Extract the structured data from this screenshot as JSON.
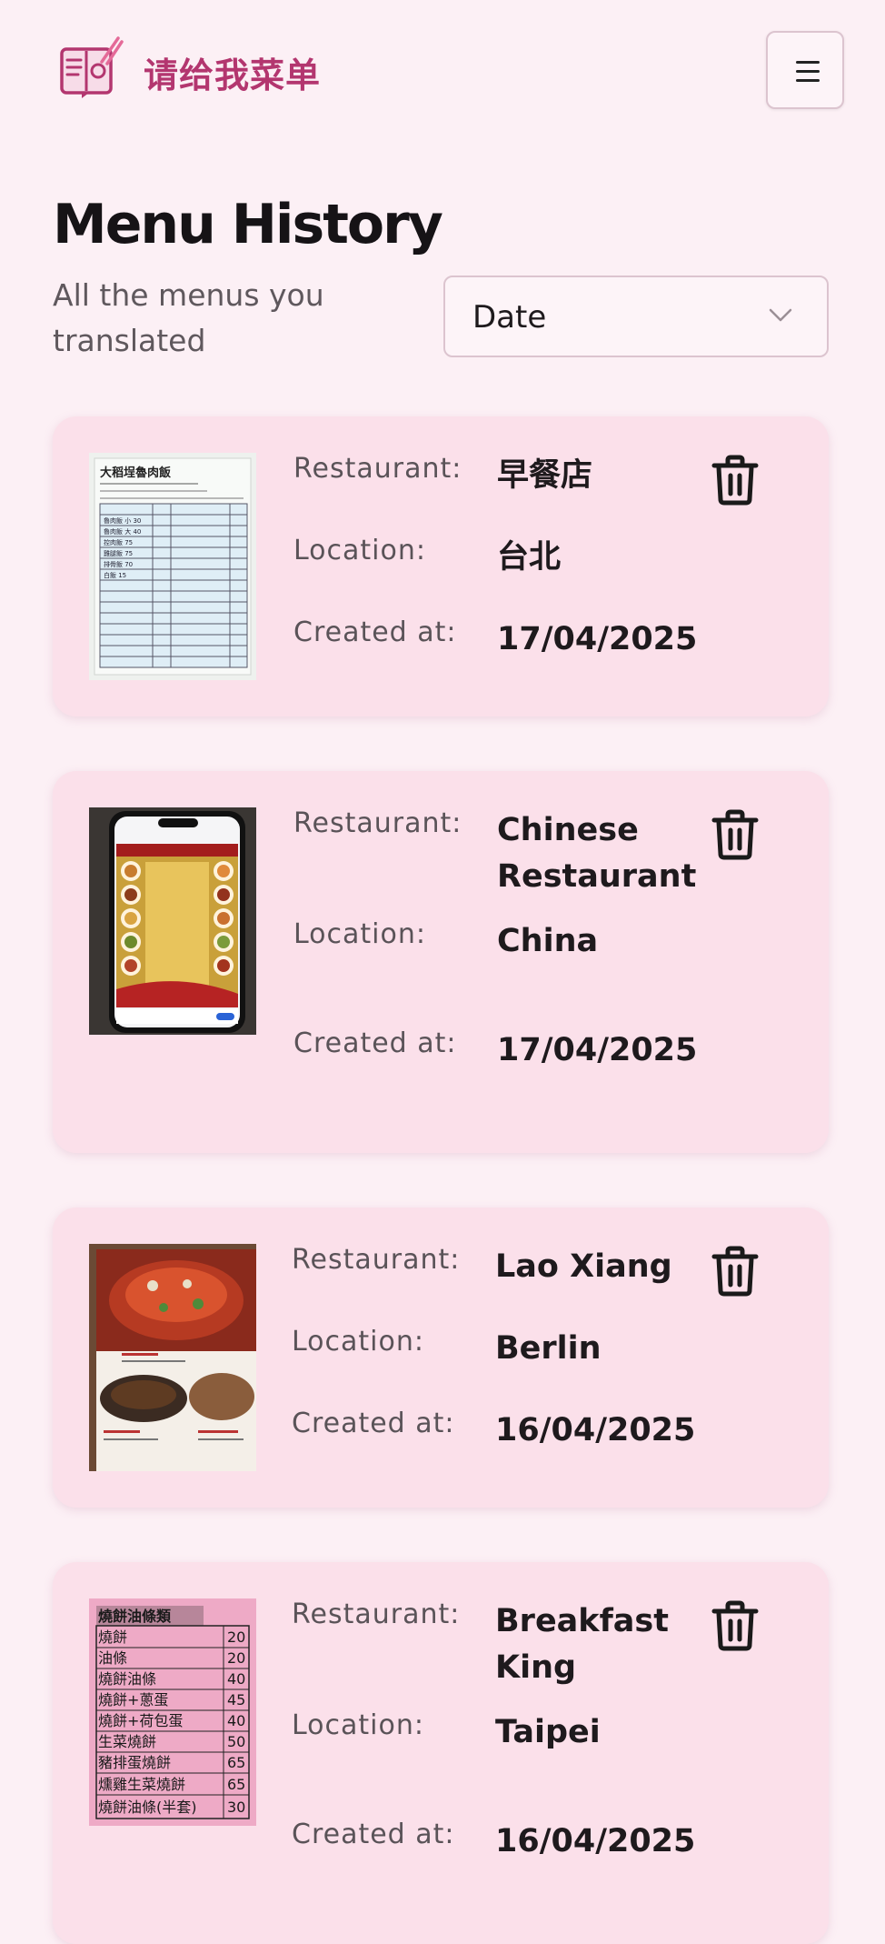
{
  "brand": {
    "name": "请给我菜单"
  },
  "page": {
    "title": "Menu History",
    "subtitle": "All the menus you translated"
  },
  "sort": {
    "selected": "Date"
  },
  "labels": {
    "restaurant": "Restaurant:",
    "location": "Location:",
    "created": "Created at:"
  },
  "menus": [
    {
      "restaurant": "早餐店",
      "location": "台北",
      "created": "17/04/2025"
    },
    {
      "restaurant": "Chinese Restaurant",
      "location": "China",
      "created": "17/04/2025"
    },
    {
      "restaurant": "Lao Xiang",
      "location": "Berlin",
      "created": "16/04/2025"
    },
    {
      "restaurant": "Breakfast King",
      "location": "Taipei",
      "created": "16/04/2025"
    }
  ],
  "menu_photo_text": {
    "first": {
      "title": "大稻埕魯肉飯",
      "rows": [
        "魯肉飯 小 30",
        "魯肉飯 大 40",
        "控肉飯 75",
        "雞腿飯 75",
        "排骨飯 70",
        "白飯 15"
      ]
    },
    "fourth": {
      "title": "燒餅油條類",
      "rows": [
        {
          "name": "燒餅",
          "price": "20"
        },
        {
          "name": "油條",
          "price": "20"
        },
        {
          "name": "燒餅油條",
          "price": "40"
        },
        {
          "name": "燒餅+蔥蛋",
          "price": "45"
        },
        {
          "name": "燒餅+荷包蛋",
          "price": "40"
        },
        {
          "name": "生菜燒餅",
          "price": "50"
        },
        {
          "name": "豬排蛋燒餅",
          "price": "65"
        },
        {
          "name": "燻雞生菜燒餅",
          "price": "65"
        },
        {
          "name": "燒餅油條(半套)",
          "price": "30"
        }
      ]
    }
  },
  "colors": {
    "background": "#fcf0f5",
    "card": "#fbe0ea",
    "brand": "#b3366f"
  },
  "icons": {
    "logo": "menu-book-chopsticks-icon",
    "menu": "hamburger-icon",
    "sort": "chevron-down-icon",
    "delete": "trash-icon"
  }
}
